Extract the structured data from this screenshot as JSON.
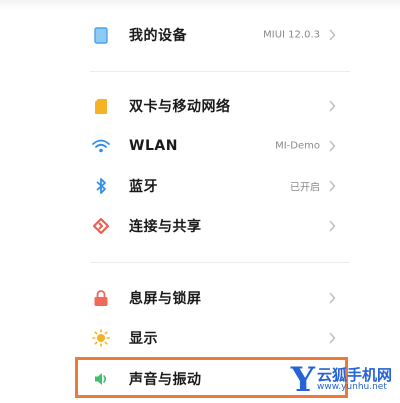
{
  "colors": {
    "accent": "#ee7a3a",
    "device_icon": "#4fa3e8",
    "sim_icon": "#f5b324",
    "wifi_icon": "#2f8ef0",
    "bluetooth_icon": "#2f8ef0",
    "share_icon": "#ee5a4a",
    "lock_icon": "#f06a5a",
    "display_icon": "#f5b324",
    "sound_icon": "#3cbf6e"
  },
  "settings": {
    "my_device": {
      "label": "我的设备",
      "value": "MIUI 12.0.3",
      "icon": "phone-icon"
    },
    "sim": {
      "label": "双卡与移动网络",
      "icon": "sim-card-icon"
    },
    "wlan": {
      "label": "WLAN",
      "value": "MI-Demo",
      "icon": "wifi-icon"
    },
    "bluetooth": {
      "label": "蓝牙",
      "value": "已开启",
      "icon": "bluetooth-icon"
    },
    "share": {
      "label": "连接与共享",
      "icon": "share-icon"
    },
    "lock": {
      "label": "息屏与锁屏",
      "icon": "lock-icon"
    },
    "display": {
      "label": "显示",
      "icon": "sun-icon"
    },
    "sound": {
      "label": "声音与振动",
      "icon": "speaker-icon"
    }
  },
  "watermark": {
    "letter": "Y",
    "name": "云狐手机网",
    "url": "www.yunhu.net"
  }
}
